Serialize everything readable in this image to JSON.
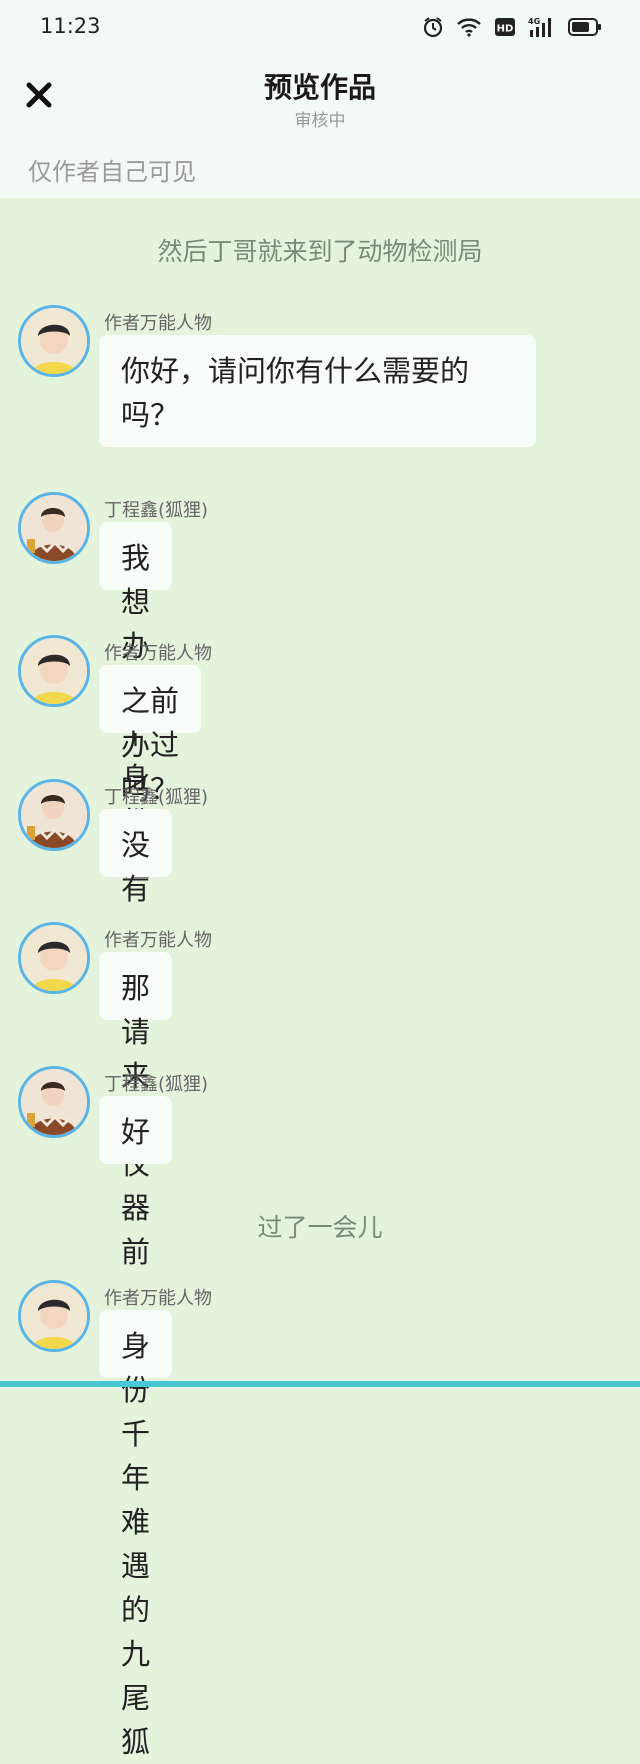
{
  "status": {
    "time": "11:23"
  },
  "header": {
    "title": "预览作品",
    "subtitle": "审核中",
    "visibility": "仅作者自己可见"
  },
  "chat": {
    "narration_1": "然后丁哥就来到了动物检测局",
    "narration_2": "过了一会儿",
    "messages": [
      {
        "speaker": "作者万能人物",
        "text": "你好，请问你有什么需要的吗？"
      },
      {
        "speaker": "丁程鑫(狐狸)",
        "text": "我想办一个身份证"
      },
      {
        "speaker": "作者万能人物",
        "text": "之前办过吗？"
      },
      {
        "speaker": "丁程鑫(狐狸)",
        "text": "没有"
      },
      {
        "speaker": "作者万能人物",
        "text": "那请来到仪器前"
      },
      {
        "speaker": "丁程鑫(狐狸)",
        "text": "好"
      },
      {
        "speaker": "作者万能人物",
        "text": "身份 千年难遇的九尾狐"
      }
    ]
  },
  "colors": {
    "background": "#e4f4dc",
    "header_background": "#f1fbf3",
    "bubble": "#f7fdf7",
    "avatar_ring": "#5ab4e6",
    "accent_bar": "#46c8d6"
  },
  "icons": [
    "close-icon",
    "alarm-icon",
    "wifi-icon",
    "hd-icon",
    "signal-4g-icon",
    "battery-icon"
  ]
}
